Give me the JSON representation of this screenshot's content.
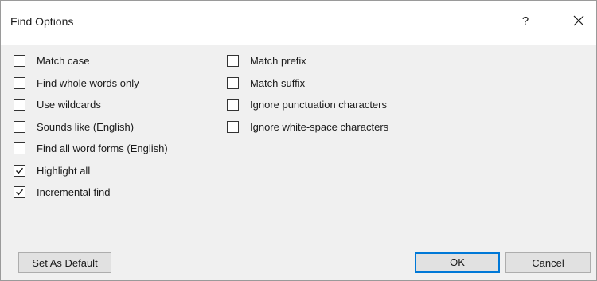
{
  "dialog": {
    "title": "Find Options",
    "help_label": "?",
    "close_icon": "close-icon"
  },
  "options_left": [
    {
      "label": "Match case",
      "checked": false
    },
    {
      "label": "Find whole words only",
      "checked": false
    },
    {
      "label": "Use wildcards",
      "checked": false
    },
    {
      "label": "Sounds like (English)",
      "checked": false
    },
    {
      "label": "Find all word forms (English)",
      "checked": false
    },
    {
      "label": "Highlight all",
      "checked": true
    },
    {
      "label": "Incremental find",
      "checked": true
    }
  ],
  "options_right": [
    {
      "label": "Match prefix",
      "checked": false
    },
    {
      "label": "Match suffix",
      "checked": false
    },
    {
      "label": "Ignore punctuation characters",
      "checked": false
    },
    {
      "label": "Ignore white-space characters",
      "checked": false
    }
  ],
  "buttons": {
    "set_default": "Set As Default",
    "ok": "OK",
    "cancel": "Cancel"
  },
  "colors": {
    "accent": "#0078d7",
    "dialog_bg": "#f0f0f0",
    "titlebar_bg": "#ffffff"
  }
}
